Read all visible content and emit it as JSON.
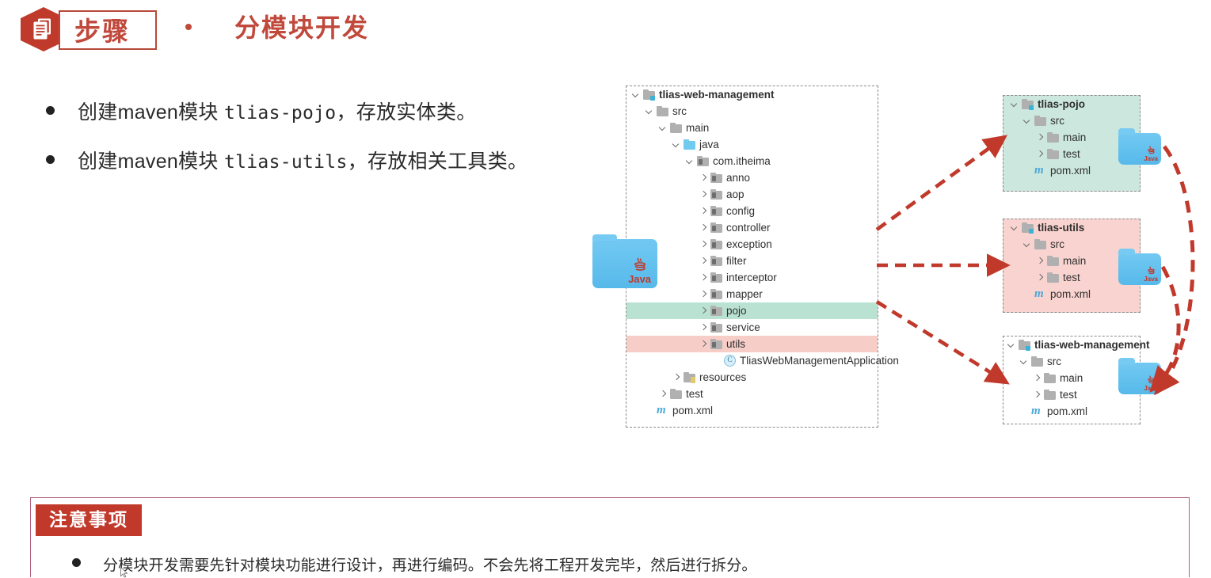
{
  "header": {
    "badge_icon": "document-hexagon-icon",
    "badge_label": "步骤",
    "separator_dot": "bullet-dot-icon",
    "title": "分模块开发",
    "accent_color": "#c0493c"
  },
  "bullets": [
    {
      "dot": "bullet-dot-icon",
      "prefix": "创建maven模块 ",
      "code": "tlias-pojo",
      "suffix": "，存放实体类。"
    },
    {
      "dot": "bullet-dot-icon",
      "prefix": "创建maven模块 ",
      "code": "tlias-utils",
      "suffix": "，存放相关工具类。"
    }
  ],
  "diagram": {
    "highlight_green": "#b9e2d2",
    "highlight_pink": "#f7cdc8",
    "arrow_color": "#c0392b",
    "panel_border_color": "#8b8b8b",
    "main_project": {
      "name": "tlias-web-management",
      "rows": [
        {
          "indent": 0,
          "chevron": "down",
          "icon": "module-folder-icon",
          "label": "tlias-web-management",
          "bold": true,
          "highlight": "none"
        },
        {
          "indent": 1,
          "chevron": "down",
          "icon": "folder-icon",
          "label": "src",
          "bold": false,
          "highlight": "none"
        },
        {
          "indent": 2,
          "chevron": "down",
          "icon": "folder-icon",
          "label": "main",
          "bold": false,
          "highlight": "none"
        },
        {
          "indent": 3,
          "chevron": "down",
          "icon": "source-folder-icon",
          "label": "java",
          "bold": false,
          "highlight": "none"
        },
        {
          "indent": 4,
          "chevron": "down",
          "icon": "package-folder-icon",
          "label": "com.itheima",
          "bold": false,
          "highlight": "none"
        },
        {
          "indent": 5,
          "chevron": "right",
          "icon": "package-folder-icon",
          "label": "anno",
          "bold": false,
          "highlight": "none"
        },
        {
          "indent": 5,
          "chevron": "right",
          "icon": "package-folder-icon",
          "label": "aop",
          "bold": false,
          "highlight": "none"
        },
        {
          "indent": 5,
          "chevron": "right",
          "icon": "package-folder-icon",
          "label": "config",
          "bold": false,
          "highlight": "none"
        },
        {
          "indent": 5,
          "chevron": "right",
          "icon": "package-folder-icon",
          "label": "controller",
          "bold": false,
          "highlight": "none"
        },
        {
          "indent": 5,
          "chevron": "right",
          "icon": "package-folder-icon",
          "label": "exception",
          "bold": false,
          "highlight": "none"
        },
        {
          "indent": 5,
          "chevron": "right",
          "icon": "package-folder-icon",
          "label": "filter",
          "bold": false,
          "highlight": "none"
        },
        {
          "indent": 5,
          "chevron": "right",
          "icon": "package-folder-icon",
          "label": "interceptor",
          "bold": false,
          "highlight": "none"
        },
        {
          "indent": 5,
          "chevron": "right",
          "icon": "package-folder-icon",
          "label": "mapper",
          "bold": false,
          "highlight": "none"
        },
        {
          "indent": 5,
          "chevron": "right",
          "icon": "package-folder-icon",
          "label": "pojo",
          "bold": false,
          "highlight": "green"
        },
        {
          "indent": 5,
          "chevron": "right",
          "icon": "package-folder-icon",
          "label": "service",
          "bold": false,
          "highlight": "none"
        },
        {
          "indent": 5,
          "chevron": "right",
          "icon": "package-folder-icon",
          "label": "utils",
          "bold": false,
          "highlight": "pink"
        },
        {
          "indent": 6,
          "chevron": "none",
          "icon": "java-class-icon",
          "label": "TliasWebManagementApplication",
          "bold": false,
          "highlight": "none"
        },
        {
          "indent": 3,
          "chevron": "right",
          "icon": "resources-folder-icon",
          "label": "resources",
          "bold": false,
          "highlight": "none"
        },
        {
          "indent": 2,
          "chevron": "right",
          "icon": "folder-icon",
          "label": "test",
          "bold": false,
          "highlight": "none"
        },
        {
          "indent": 1,
          "chevron": "none",
          "icon": "maven-pom-icon",
          "label": "pom.xml",
          "bold": false,
          "highlight": "none"
        }
      ]
    },
    "modules": [
      {
        "name": "tlias-pojo",
        "background": "#cce7dd",
        "java_icon_label": "Java",
        "rows": [
          {
            "indent": 0,
            "chevron": "down",
            "icon": "module-folder-icon",
            "label": "tlias-pojo",
            "bold": true
          },
          {
            "indent": 1,
            "chevron": "down",
            "icon": "folder-icon",
            "label": "src",
            "bold": false
          },
          {
            "indent": 2,
            "chevron": "right",
            "icon": "folder-icon",
            "label": "main",
            "bold": false
          },
          {
            "indent": 2,
            "chevron": "right",
            "icon": "folder-icon",
            "label": "test",
            "bold": false
          },
          {
            "indent": 1,
            "chevron": "none",
            "icon": "maven-pom-icon",
            "label": "pom.xml",
            "bold": false
          }
        ]
      },
      {
        "name": "tlias-utils",
        "background": "#f9d3cf",
        "java_icon_label": "Java",
        "rows": [
          {
            "indent": 0,
            "chevron": "down",
            "icon": "module-folder-icon",
            "label": "tlias-utils",
            "bold": true
          },
          {
            "indent": 1,
            "chevron": "down",
            "icon": "folder-icon",
            "label": "src",
            "bold": false
          },
          {
            "indent": 2,
            "chevron": "right",
            "icon": "folder-icon",
            "label": "main",
            "bold": false
          },
          {
            "indent": 2,
            "chevron": "right",
            "icon": "folder-icon",
            "label": "test",
            "bold": false
          },
          {
            "indent": 1,
            "chevron": "none",
            "icon": "maven-pom-icon",
            "label": "pom.xml",
            "bold": false
          }
        ]
      },
      {
        "name": "tlias-web-management",
        "background": "#ffffff",
        "java_icon_label": "Java",
        "rows": [
          {
            "indent": 0,
            "chevron": "down",
            "icon": "module-folder-icon",
            "label": "tlias-web-management",
            "bold": true
          },
          {
            "indent": 1,
            "chevron": "down",
            "icon": "folder-icon",
            "label": "src",
            "bold": false
          },
          {
            "indent": 2,
            "chevron": "right",
            "icon": "folder-icon",
            "label": "main",
            "bold": false
          },
          {
            "indent": 2,
            "chevron": "right",
            "icon": "folder-icon",
            "label": "test",
            "bold": false
          },
          {
            "indent": 1,
            "chevron": "none",
            "icon": "maven-pom-icon",
            "label": "pom.xml",
            "bold": false
          }
        ]
      }
    ],
    "center_icon": {
      "name": "java-folder-icon",
      "label": "Java"
    }
  },
  "notice": {
    "tag_label": "注意事项",
    "border_color": "#b0607e",
    "tag_color": "#c0392b",
    "items": [
      {
        "dot": "bullet-dot-icon",
        "text": "分模块开发需要先针对模块功能进行设计，再进行编码。不会先将工程开发完毕，然后进行拆分。"
      }
    ]
  }
}
